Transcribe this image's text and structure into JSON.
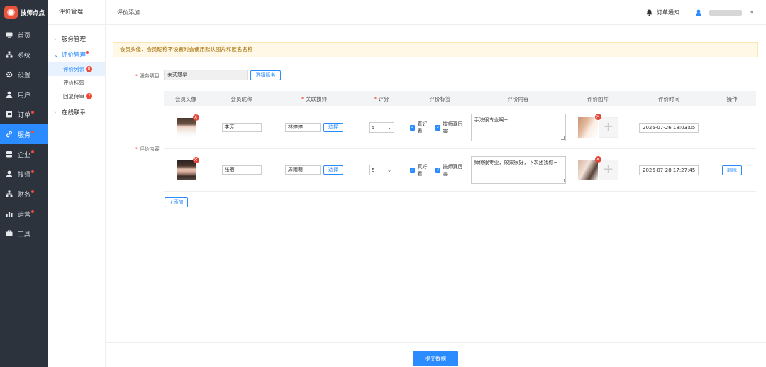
{
  "app": {
    "name": "技师点点"
  },
  "sidebar": {
    "items": [
      {
        "label": "首页",
        "icon": "monitor-icon",
        "badge": false
      },
      {
        "label": "系统",
        "icon": "sitemap-icon",
        "badge": false
      },
      {
        "label": "设置",
        "icon": "gear-icon",
        "badge": false
      },
      {
        "label": "用户",
        "icon": "user-icon",
        "badge": false
      },
      {
        "label": "订单",
        "icon": "order-icon",
        "badge": true
      },
      {
        "label": "服务",
        "icon": "link-icon",
        "badge": true
      },
      {
        "label": "企业",
        "icon": "building-icon",
        "badge": true
      },
      {
        "label": "技师",
        "icon": "user-icon",
        "badge": true
      },
      {
        "label": "财务",
        "icon": "sitemap-icon",
        "badge": true
      },
      {
        "label": "运营",
        "icon": "chart-icon",
        "badge": true
      },
      {
        "label": "工具",
        "icon": "briefcase-icon",
        "badge": false
      }
    ]
  },
  "subnav": {
    "title": "评价管理",
    "groups": [
      {
        "label": "服务管理"
      },
      {
        "label": "评价管理"
      },
      {
        "label": "在线联系"
      }
    ],
    "items": [
      {
        "label": "评价列表",
        "count": "8"
      },
      {
        "label": "评价标签",
        "count": ""
      },
      {
        "label": "回复待审",
        "count": "7"
      }
    ]
  },
  "header": {
    "breadcrumb": "评价添加",
    "notify_label": "订单通知",
    "user_name": "●●●●●●●●"
  },
  "notice": "会员头像、会员昵称不设置时会使用默认图片和匿名名称",
  "form": {
    "service_label": "服务项目",
    "service_value": "泰式悠享",
    "service_button": "选择服务",
    "content_label": "评价内容"
  },
  "table": {
    "columns": [
      "会员头像",
      "会员昵称",
      "关联技师",
      "评分",
      "评价标签",
      "评价内容",
      "评价图片",
      "评价时间",
      "操作"
    ],
    "required_columns": [
      "关联技师",
      "评分"
    ],
    "select_button": "选择",
    "delete_button": "删除",
    "rows": [
      {
        "nickname": "李芳",
        "technician": "林婷婷",
        "score": "5",
        "tags": [
          "真好看",
          "技师真厉害"
        ],
        "content": "手法很专业啊~",
        "time": "2026-07-26 18:03:05",
        "show_delete": false
      },
      {
        "nickname": "张蓓",
        "technician": "周雨萌",
        "score": "5",
        "tags": [
          "真好看",
          "技师真厉害"
        ],
        "content": "师傅很专业，效果很好，下次还找你~",
        "time": "2026-07-28 17:27:45",
        "show_delete": true
      }
    ]
  },
  "add_button": "+添加",
  "submit_button": "提交数据",
  "colors": {
    "primary": "#2b8cff",
    "sidebar_bg": "#2c333d",
    "danger": "#f04a3a",
    "notice_bg": "#fff8e6"
  }
}
